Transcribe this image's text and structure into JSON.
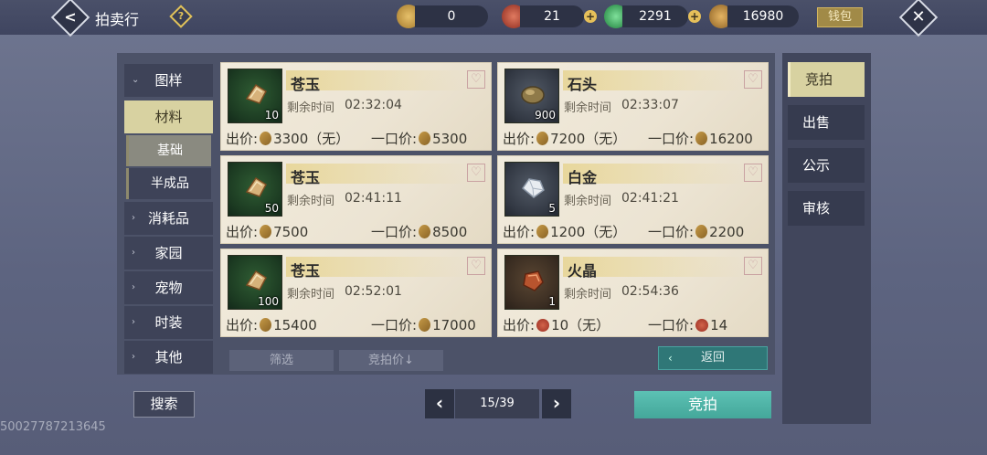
{
  "header": {
    "title": "拍卖行",
    "help": "?",
    "back": "<",
    "close": "✕",
    "wallet_label": "钱包",
    "currencies": [
      {
        "name": "currency-1",
        "value": "0",
        "color": "#c99a3d"
      },
      {
        "name": "currency-2",
        "value": "21",
        "color": "#b8412e"
      },
      {
        "name": "currency-3",
        "value": "2291",
        "color": "#3fae5c"
      },
      {
        "name": "currency-4",
        "value": "16980",
        "color": "#c28f3e"
      }
    ],
    "plus": "+"
  },
  "sidebar": {
    "categories": [
      {
        "label": "图样",
        "arrow": "⌄"
      },
      {
        "label": "材料",
        "arrow": ""
      },
      {
        "label": "消耗品",
        "arrow": "›"
      },
      {
        "label": "家园",
        "arrow": "›"
      },
      {
        "label": "宠物",
        "arrow": "›"
      },
      {
        "label": "时装",
        "arrow": "›"
      },
      {
        "label": "其他",
        "arrow": "›"
      }
    ],
    "subcategories": [
      "基础",
      "半成品"
    ]
  },
  "items": [
    {
      "name": "苍玉",
      "count": "10",
      "time_label": "剩余时间",
      "time": "02:32:04",
      "price_label": "出价:",
      "price": "3300（无）",
      "buyout_label": "一口价:",
      "buyout": "5300",
      "thumb": "green",
      "coin": "gold"
    },
    {
      "name": "石头",
      "count": "900",
      "time_label": "剩余时间",
      "time": "02:33:07",
      "price_label": "出价:",
      "price": "7200（无）",
      "buyout_label": "一口价:",
      "buyout": "16200",
      "thumb": "grey",
      "coin": "gold"
    },
    {
      "name": "苍玉",
      "count": "50",
      "time_label": "剩余时间",
      "time": "02:41:11",
      "price_label": "出价:",
      "price": "7500",
      "buyout_label": "一口价:",
      "buyout": "8500",
      "thumb": "green",
      "coin": "gold"
    },
    {
      "name": "白金",
      "count": "5",
      "time_label": "剩余时间",
      "time": "02:41:21",
      "price_label": "出价:",
      "price": "1200（无）",
      "buyout_label": "一口价:",
      "buyout": "2200",
      "thumb": "grey",
      "coin": "gold"
    },
    {
      "name": "苍玉",
      "count": "100",
      "time_label": "剩余时间",
      "time": "02:52:01",
      "price_label": "出价:",
      "price": "15400",
      "buyout_label": "一口价:",
      "buyout": "17000",
      "thumb": "green",
      "coin": "gold"
    },
    {
      "name": "火晶",
      "count": "1",
      "time_label": "剩余时间",
      "time": "02:54:36",
      "price_label": "出价:",
      "price": "10（无）",
      "buyout_label": "一口价:",
      "buyout": "14",
      "thumb": "brown",
      "coin": "red"
    }
  ],
  "controls": {
    "filter": "筛选",
    "sort": "竞拍价↓",
    "return": "返回",
    "return_arrow": "‹",
    "search": "搜索",
    "prev": "‹",
    "next": "›",
    "page": "15/39",
    "bid": "竞拍"
  },
  "right_tabs": [
    "竞拍",
    "出售",
    "公示",
    "审核"
  ],
  "player_id": "50027787213645"
}
